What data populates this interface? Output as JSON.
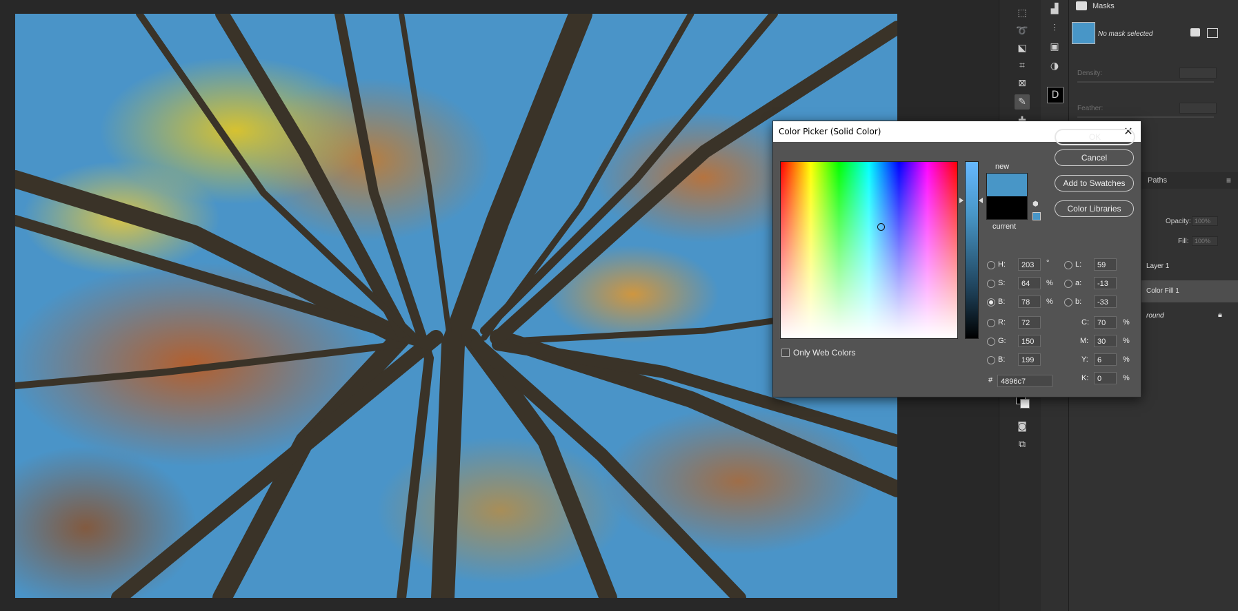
{
  "masks_panel": {
    "title": "Masks",
    "mask_status": "No mask selected",
    "density_label": "Density:",
    "feather_label": "Feather:"
  },
  "layers_panel": {
    "tab_paths": "Paths",
    "opacity_label": "Opacity:",
    "opacity_value": "100%",
    "fill_label": "Fill:",
    "fill_value": "100%",
    "layers": [
      {
        "name": "Layer 1"
      },
      {
        "name": "Color Fill 1"
      },
      {
        "name": "round"
      }
    ]
  },
  "color_picker": {
    "title": "Color Picker (Solid Color)",
    "new_label": "new",
    "current_label": "current",
    "new_color": "#4896c7",
    "current_color": "#000000",
    "buttons": {
      "ok": "OK",
      "cancel": "Cancel",
      "add_to_swatches": "Add to Swatches",
      "color_libraries": "Color Libraries"
    },
    "only_web_colors": "Only Web Colors",
    "hsb": {
      "h_label": "H:",
      "h": "203",
      "h_unit": "°",
      "s_label": "S:",
      "s": "64",
      "s_unit": "%",
      "b_label": "B:",
      "b": "78",
      "b_unit": "%"
    },
    "rgb": {
      "r_label": "R:",
      "r": "72",
      "g_label": "G:",
      "g": "150",
      "b_label": "B:",
      "b": "199"
    },
    "lab": {
      "l_label": "L:",
      "l": "59",
      "a_label": "a:",
      "a": "-13",
      "b_label": "b:",
      "b": "-33"
    },
    "cmyk": {
      "c_label": "C:",
      "c": "70",
      "m_label": "M:",
      "m": "30",
      "y_label": "Y:",
      "y": "6",
      "k_label": "K:",
      "k": "0",
      "unit": "%"
    },
    "hex_label": "#",
    "hex": "4896c7",
    "selected_mode": "B"
  }
}
